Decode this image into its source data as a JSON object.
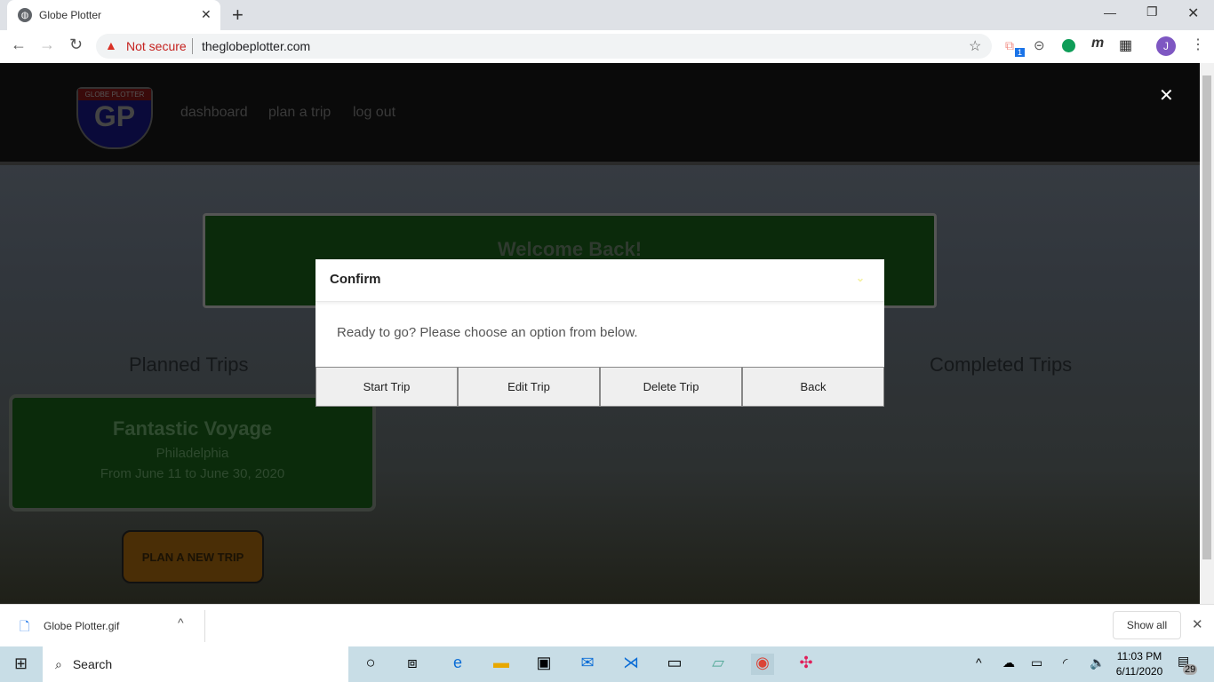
{
  "browser": {
    "tab_title": "Globe Plotter",
    "security_label": "Not secure",
    "url": "theglobeplotter.com",
    "ext_badge": "1",
    "profile_initial": "J"
  },
  "site": {
    "logo_text": "GLOBE PLOTTER",
    "logo_initials": "GP",
    "nav": [
      "dashboard",
      "plan a trip",
      "log out"
    ],
    "close_symbol": "✕",
    "welcome": "Welcome Back!",
    "planned_heading": "Planned Trips",
    "completed_heading": "Completed Trips",
    "trip": {
      "name": "Fantastic Voyage",
      "city": "Philadelphia",
      "dates": "From June 11 to June 30, 2020"
    },
    "plan_button": "PLAN A NEW TRIP"
  },
  "modal": {
    "title": "Confirm",
    "message": "Ready to go? Please choose an option from below.",
    "buttons": [
      "Start Trip",
      "Edit Trip",
      "Delete Trip",
      "Back"
    ]
  },
  "downloads": {
    "file": "Globe Plotter.gif",
    "show_all": "Show all"
  },
  "taskbar": {
    "search": "Search",
    "time": "11:03 PM",
    "date": "6/11/2020",
    "notifications": "29"
  }
}
